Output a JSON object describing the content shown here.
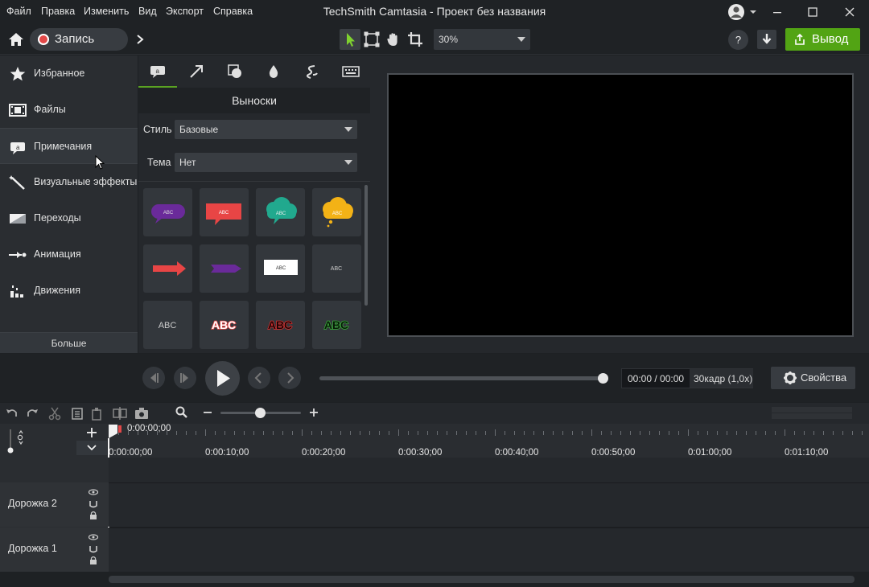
{
  "window": {
    "title": "TechSmith Camtasia - Проект без названия"
  },
  "menu": [
    "Файл",
    "Правка",
    "Изменить",
    "Вид",
    "Экспорт",
    "Справка"
  ],
  "toolbar": {
    "record_label": "Запись",
    "zoom_value": "30%",
    "export_label": "Вывод",
    "help_label": "?"
  },
  "sidebar": {
    "items": [
      {
        "label": "Избранное",
        "icon": "star-icon"
      },
      {
        "label": "Файлы",
        "icon": "film-icon"
      },
      {
        "label": "Примечания",
        "icon": "annotation-icon"
      },
      {
        "label": "Визуальные эффекты",
        "icon": "wand-icon"
      },
      {
        "label": "Переходы",
        "icon": "transition-icon"
      },
      {
        "label": "Анимация",
        "icon": "animation-icon"
      },
      {
        "label": "Движения",
        "icon": "behaviors-icon"
      }
    ],
    "more_label": "Больше"
  },
  "annotations": {
    "title": "Выноски",
    "style_label": "Стиль",
    "style_value": "Базовые",
    "theme_label": "Тема",
    "theme_value": "Нет",
    "tiles": [
      "ABC",
      "ABC",
      "ABC",
      "ABC",
      "",
      "",
      "ABC",
      "ABC",
      "ABC",
      "ABC",
      "ABC",
      "ABC"
    ]
  },
  "player": {
    "time": "00:00 / 00:00",
    "fps": "30кадр (1,0x)",
    "properties_label": "Свойства"
  },
  "timeline": {
    "playhead_time": "0:00:00;00",
    "ruler_labels": [
      "0:00:00;00",
      "0:00:10;00",
      "0:00:20;00",
      "0:00:30;00",
      "0:00:40;00",
      "0:00:50;00",
      "0:01:00;00",
      "0:01:10;00"
    ],
    "tracks": [
      "Дорожка 2",
      "Дорожка 1"
    ]
  },
  "colors": {
    "accent": "#52a414",
    "record": "#e24848"
  }
}
